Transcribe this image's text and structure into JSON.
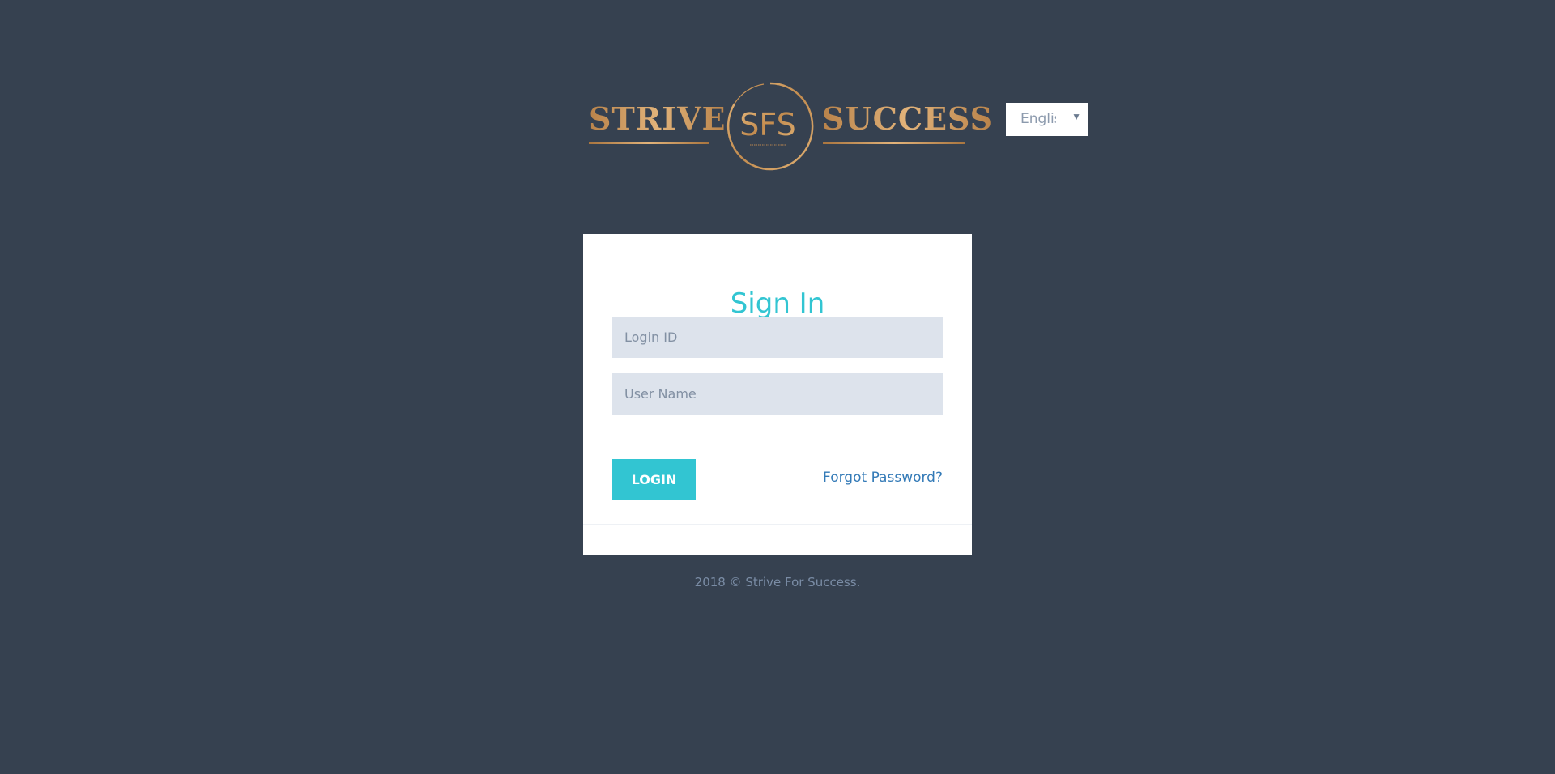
{
  "brand": {
    "word_left": "STRIVE",
    "monogram": "SFS",
    "word_right": "SUCCESS",
    "color": "#c9955a"
  },
  "language": {
    "selected": "English"
  },
  "login": {
    "title": "Sign In",
    "login_id_placeholder": "Login ID",
    "user_name_placeholder": "User Name",
    "login_button": "LOGIN",
    "forgot_password": "Forgot Password?",
    "accent_color": "#32c5d2"
  },
  "footer": {
    "copyright": "2018 © Strive For Success."
  },
  "theme": {
    "background": "#364150",
    "card": "#ffffff",
    "input_bg": "#dde3ec",
    "link": "#337ab7"
  }
}
